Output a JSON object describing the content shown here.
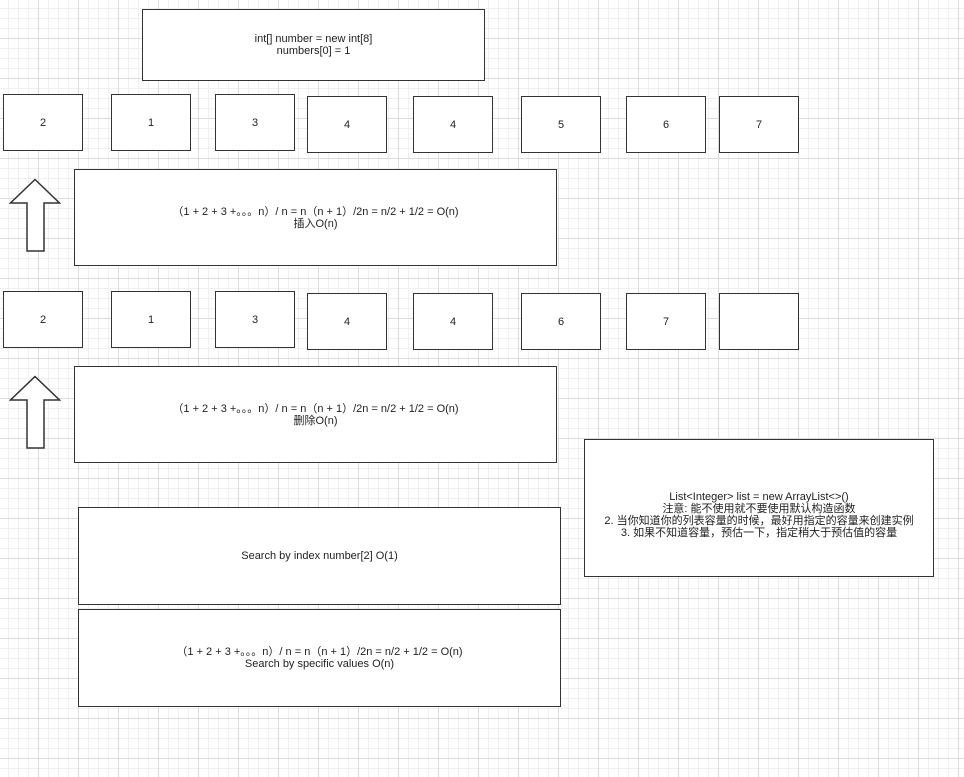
{
  "top_box": {
    "line1": "int[] number = new int[8]",
    "line2": "numbers[0] = 1"
  },
  "array_row_1": [
    "2",
    "1",
    "3",
    "4",
    "4",
    "5",
    "6",
    "7"
  ],
  "insert_box": {
    "line1": "（1 + 2 + 3 +。。。n）/ n = n（n + 1）/2n = n/2 + 1/2 = O(n)",
    "line2": "插入O(n)"
  },
  "array_row_2": [
    "2",
    "1",
    "3",
    "4",
    "4",
    "6",
    "7",
    ""
  ],
  "delete_box": {
    "line1": "（1 + 2 + 3 +。。。n）/ n = n（n + 1）/2n = n/2 + 1/2 = O(n)",
    "line2": "删除O(n)"
  },
  "search_index_box": {
    "line1": "Search by index number[2] O(1)"
  },
  "search_value_box": {
    "line1": "（1 + 2 + 3 +。。。n）/ n = n（n + 1）/2n = n/2 + 1/2 = O(n)",
    "line2": "Search by specific values O(n)"
  },
  "list_note_box": {
    "line1": "List<Integer> list = new ArrayList<>()",
    "line2": "注意: 能不使用就不要使用默认构造函数",
    "line3": "2. 当你知道你的列表容量的时候，最好用指定的容量来创建实例",
    "line4": "3. 如果不知道容量，预估一下，指定稍大于预估值的容量"
  }
}
